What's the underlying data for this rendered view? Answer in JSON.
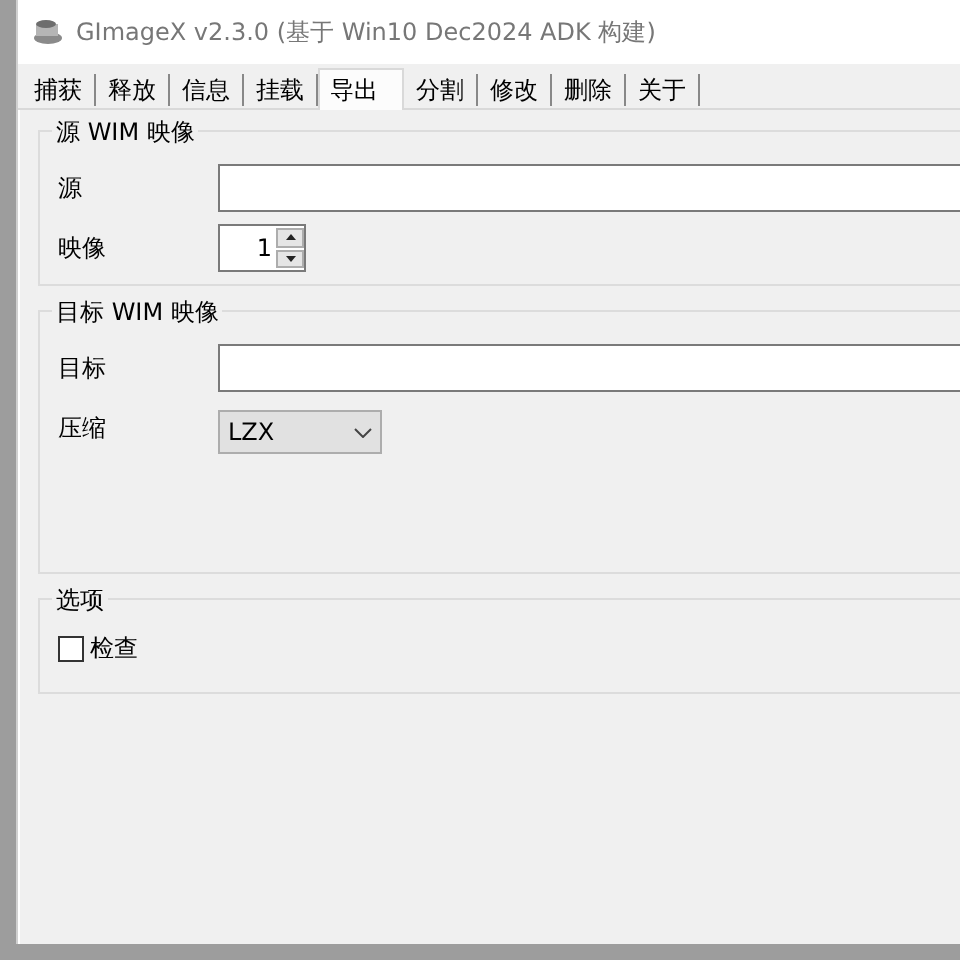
{
  "window": {
    "title": "GImageX v2.3.0 (基于 Win10 Dec2024 ADK 构建)"
  },
  "tabs": [
    {
      "label": "捕获",
      "selected": false
    },
    {
      "label": "释放",
      "selected": false
    },
    {
      "label": "信息",
      "selected": false
    },
    {
      "label": "挂载",
      "selected": false
    },
    {
      "label": "导出",
      "selected": true
    },
    {
      "label": "分割",
      "selected": false
    },
    {
      "label": "修改",
      "selected": false
    },
    {
      "label": "删除",
      "selected": false
    },
    {
      "label": "关于",
      "selected": false
    }
  ],
  "groups": [
    {
      "title": "源 WIM 映像",
      "rows": [
        {
          "kind": "text",
          "label": "源"
        },
        {
          "kind": "spin",
          "label": "映像",
          "value": "1"
        }
      ]
    },
    {
      "title": "目标 WIM 映像",
      "rows": [
        {
          "kind": "text",
          "label": "目标"
        },
        {
          "kind": "combo",
          "label": "压缩",
          "value": "LZX"
        }
      ]
    },
    {
      "title": "选项",
      "rows": [
        {
          "kind": "check",
          "label": "检查",
          "checked": false
        }
      ]
    }
  ]
}
